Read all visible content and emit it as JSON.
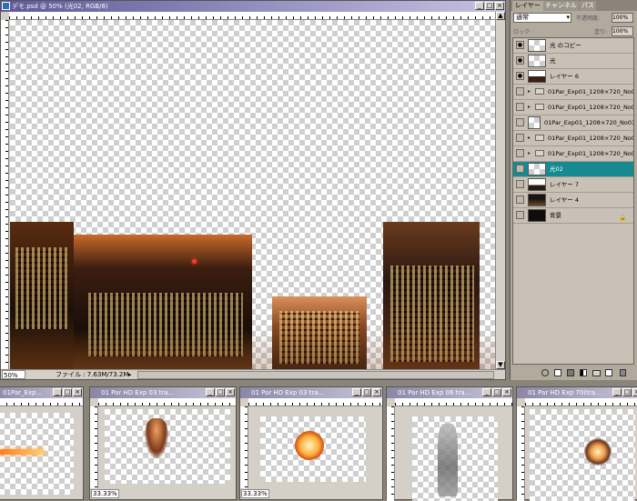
{
  "main_window": {
    "title": "デモ.psd @ 50% (光02, RGB/8)",
    "zoom": "50%",
    "file_info": "ファイル : 7.63M/73.2M"
  },
  "layers_panel": {
    "tabs": [
      "レイヤー",
      "チャンネル",
      "パス"
    ],
    "blend_mode": "通常",
    "opacity_label": "不透明度:",
    "opacity_value": "100%",
    "lock_label": "ロック:",
    "fill_label": "塗り:",
    "fill_value": "100%",
    "layers": [
      {
        "name": "光 のコピー",
        "visible": true,
        "type": "layer"
      },
      {
        "name": "光",
        "visible": true,
        "type": "layer"
      },
      {
        "name": "レイヤー 6",
        "visible": true,
        "type": "layer"
      },
      {
        "name": "01Par_Exp01_1208×720_No0...",
        "visible": false,
        "type": "folder"
      },
      {
        "name": "01Par_Exp01_1208×720_No0...",
        "visible": false,
        "type": "folder"
      },
      {
        "name": "01Par_Exp01_1208×720_No03...",
        "visible": false,
        "type": "layer"
      },
      {
        "name": "01Par_Exp01_1208×720_No0...",
        "visible": false,
        "type": "folder"
      },
      {
        "name": "01Par_Exp01_1208×720_No0...",
        "visible": false,
        "type": "folder"
      },
      {
        "name": "光02",
        "visible": false,
        "type": "layer",
        "selected": true
      },
      {
        "name": "レイヤー 7",
        "visible": false,
        "type": "layer"
      },
      {
        "name": "レイヤー 4",
        "visible": false,
        "type": "layer"
      },
      {
        "name": "背景",
        "visible": false,
        "type": "layer"
      }
    ]
  },
  "sub_windows": [
    {
      "title": "01Par_Exp...",
      "zoom": ""
    },
    {
      "title": "01 Par HD Exp 03 tra...",
      "zoom": "33.33%"
    },
    {
      "title": "01 Par HD Exp 03 tra...",
      "zoom": "33.33%"
    },
    {
      "title": "01 Par HD Exp 06 tra...",
      "zoom": ""
    },
    {
      "title": "01 Par HD Exp 70(tra...",
      "zoom": ""
    }
  ],
  "icons": [
    "eye-icon",
    "folder-icon",
    "link-icon",
    "trash-icon",
    "new-layer-icon",
    "mask-icon"
  ]
}
